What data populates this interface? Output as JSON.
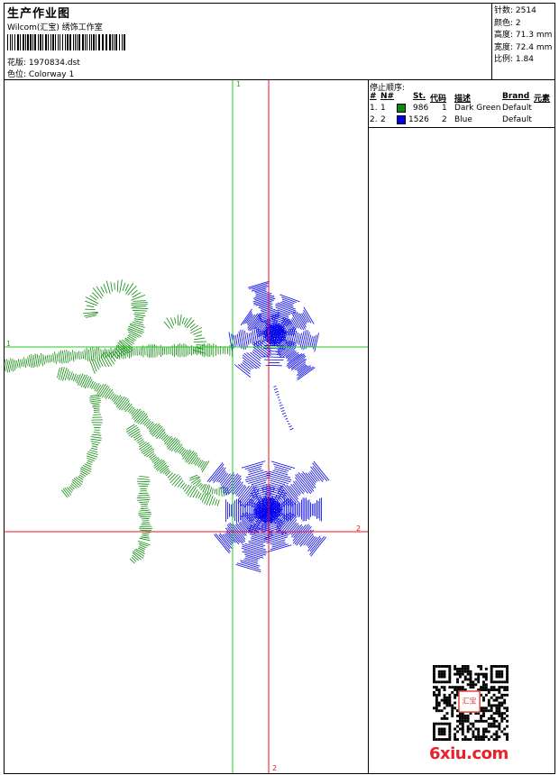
{
  "header": {
    "title": "生产作业图",
    "company": "Wilcom(汇宝) 绣饰工作室",
    "design_label": "花版:",
    "design_value": "1970834.dst",
    "colorway_label": "色位:",
    "colorway_value": "Colorway 1"
  },
  "stats": [
    {
      "label": "针数:",
      "value": "2514"
    },
    {
      "label": "颜色:",
      "value": "2"
    },
    {
      "label": "高度:",
      "value": "71.3 mm"
    },
    {
      "label": "宽度:",
      "value": "72.4 mm"
    },
    {
      "label": "比例:",
      "value": "1.84"
    }
  ],
  "stop_sequence": {
    "title": "停止顺序:",
    "columns": [
      "#",
      "N#",
      "St.",
      "代码",
      "描述",
      "Brand",
      "元素"
    ],
    "rows": [
      {
        "idx": "1.",
        "n": "1",
        "color": "#0a8a0a",
        "stitches": "986",
        "code": "1",
        "desc": "Dark Green",
        "brand": "Default"
      },
      {
        "idx": "2.",
        "n": "2",
        "color": "#0000ee",
        "stitches": "1526",
        "code": "2",
        "desc": "Blue",
        "brand": "Default"
      }
    ]
  },
  "guides": {
    "horizontal_marker_1": "1",
    "horizontal_marker_2": "2",
    "vertical_marker_1": "1",
    "vertical_marker_2": "2"
  },
  "watermark": {
    "site": "6xiu.com",
    "seal": "汇宝"
  },
  "colors": {
    "green_thread": "#0a8a0a",
    "blue_thread": "#0000ee",
    "green_guide": "#22cc22",
    "red_guide": "#ee1122"
  },
  "icons": {
    "barcode": "barcode-graphic",
    "qr": "qr-code-graphic"
  }
}
